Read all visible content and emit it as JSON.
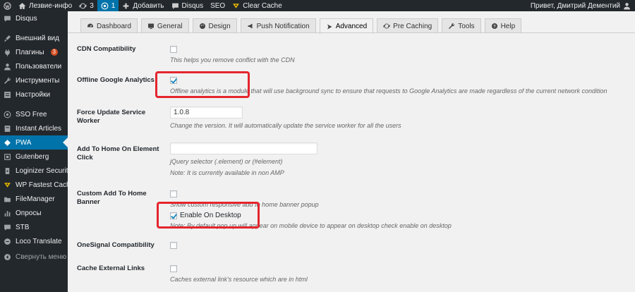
{
  "adminbar": {
    "site_name": "Лезвие-инфо",
    "updates_count": "3",
    "comments_count": "1",
    "add_new": "Добавить",
    "disqus": "Disqus",
    "seo": "SEO",
    "clear_cache": "Clear Cache",
    "greeting": "Привет, Дмитрий Дементий"
  },
  "sidebar": {
    "items": [
      {
        "label": "Disqus",
        "icon": "comment-icon"
      },
      {
        "label": "Внешний вид",
        "icon": "brush-icon"
      },
      {
        "label": "Плагины",
        "icon": "plugin-icon",
        "badge": "3"
      },
      {
        "label": "Пользователи",
        "icon": "users-icon"
      },
      {
        "label": "Инструменты",
        "icon": "wrench-icon"
      },
      {
        "label": "Настройки",
        "icon": "settings-icon"
      },
      {
        "label": "SSO Free",
        "icon": "sso-icon"
      },
      {
        "label": "Instant Articles",
        "icon": "instant-articles-icon"
      },
      {
        "label": "PWA",
        "icon": "pwa-icon",
        "current": true
      },
      {
        "label": "Gutenberg",
        "icon": "gutenberg-icon"
      },
      {
        "label": "Loginizer Security",
        "icon": "loginizer-icon"
      },
      {
        "label": "WP Fastest Cache",
        "icon": "cheetah-icon"
      },
      {
        "label": "FileManager",
        "icon": "file-manager-icon"
      },
      {
        "label": "Опросы",
        "icon": "polls-icon"
      },
      {
        "label": "STB",
        "icon": "stb-icon"
      },
      {
        "label": "Loco Translate",
        "icon": "translate-icon"
      },
      {
        "label": "Свернуть меню",
        "icon": "collapse-icon"
      }
    ]
  },
  "tabs": [
    {
      "label": "Dashboard",
      "icon": "dashboard-icon"
    },
    {
      "label": "General",
      "icon": "general-icon"
    },
    {
      "label": "Design",
      "icon": "design-icon"
    },
    {
      "label": "Push Notification",
      "icon": "megaphone-icon"
    },
    {
      "label": "Advanced",
      "icon": "advanced-icon",
      "active": true
    },
    {
      "label": "Pre Caching",
      "icon": "pre-caching-icon"
    },
    {
      "label": "Tools",
      "icon": "tools-icon"
    },
    {
      "label": "Help",
      "icon": "help-icon"
    }
  ],
  "settings": {
    "cdn": {
      "label": "CDN Compatibility",
      "checked": false,
      "desc": "This helps you remove conflict with the CDN"
    },
    "offline_ga": {
      "label": "Offline Google Analytics",
      "checked": true,
      "desc": "Offline analytics is a module that will use background sync to ensure that requests to Google Analytics are made regardless of the current network condition"
    },
    "force_update": {
      "label": "Force Update Service Worker",
      "value": "1.0.8",
      "desc": "Change the version. It will automatically update the service worker for all the users"
    },
    "add_home_click": {
      "label": "Add To Home On Element Click",
      "value": "",
      "desc1": "jQuery selector (.element) or (#element)",
      "desc2": "Note: It is currently available in non AMP"
    },
    "custom_banner": {
      "label": "Custom Add To Home Banner",
      "checked": false,
      "desc": "Show custom responsive add to home banner popup",
      "desktop_label": "Enable On Desktop",
      "desktop_checked": true,
      "desktop_note": "Note: By default pop up will appear on mobile device to appear on desktop check enable on desktop"
    },
    "onesignal": {
      "label": "OneSignal Compatibility",
      "checked": false
    },
    "cache_external": {
      "label": "Cache External Links",
      "checked": false,
      "desc": "Caches external link's resource which are in html"
    }
  },
  "colors": {
    "accent": "#0073aa",
    "highlight": "#e5252e",
    "adminbar": "#23282d"
  }
}
